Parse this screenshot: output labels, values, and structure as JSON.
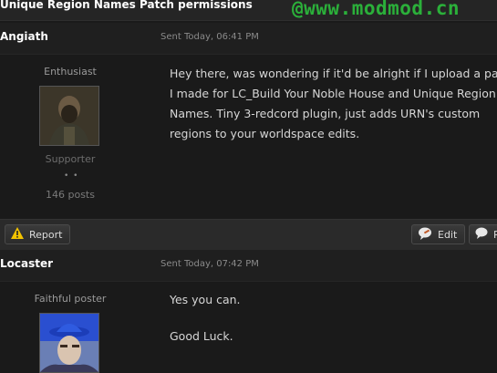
{
  "topic": {
    "title": "Unique Region Names Patch permissions"
  },
  "watermark": "@www.modmod.cn",
  "posts": [
    {
      "author": "Angiath",
      "sent": "Sent Today, 06:41 PM",
      "rank": "Enthusiast",
      "group": "Supporter",
      "pips": "• •",
      "post_count": "146 posts",
      "lines": [
        "Hey there, was wondering if it'd be alright if I upload a pa",
        "I made for LC_Build Your Noble House and Unique Region",
        "Names. Tiny 3-redcord plugin, just adds URN's custom",
        "regions to your worldspace edits."
      ]
    },
    {
      "author": "Locaster",
      "sent": "Sent Today, 07:42 PM",
      "rank": "Faithful poster",
      "lines": [
        "Yes you can.",
        "",
        "Good Luck."
      ]
    }
  ],
  "actions": {
    "report_label": "Report",
    "edit_label": "Edit",
    "reply_label": "R"
  },
  "colors": {
    "background": "#1a1a1a",
    "watermark": "#2bb03a",
    "warning": "#f2c200"
  }
}
